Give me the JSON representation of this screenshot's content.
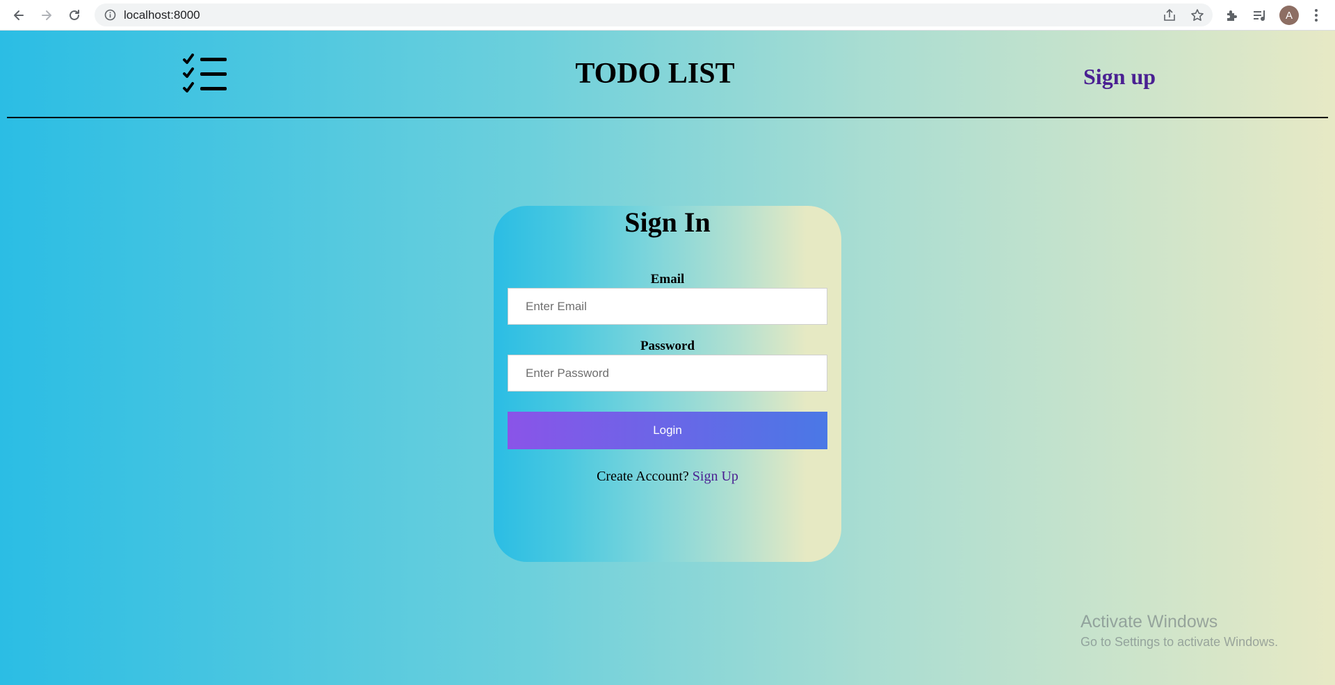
{
  "browser": {
    "url": "localhost:8000",
    "avatar_letter": "A",
    "icons": [
      "back-icon",
      "forward-icon",
      "reload-icon",
      "info-icon",
      "share-icon",
      "star-icon",
      "extensions-icon",
      "reading-list-icon",
      "menu-icon"
    ]
  },
  "header": {
    "logo_icon": "checklist-icon",
    "title": "TODO LIST",
    "signup_link": "Sign up"
  },
  "signin": {
    "title": "Sign In",
    "email_label": "Email",
    "email_placeholder": "Enter Email",
    "email_value": "",
    "password_label": "Password",
    "password_placeholder": "Enter Password",
    "password_value": "",
    "login_button": "Login",
    "create_account_text": "Create Account?",
    "create_account_link": "Sign Up"
  },
  "watermark": {
    "title": "Activate Windows",
    "subtitle": "Go to Settings to activate Windows."
  },
  "colors": {
    "page_gradient_start": "#2bbde4",
    "page_gradient_end": "#e7e9c5",
    "link_purple": "#4a2092",
    "button_gradient_start": "#8a54e8",
    "button_gradient_end": "#4a78e6"
  }
}
